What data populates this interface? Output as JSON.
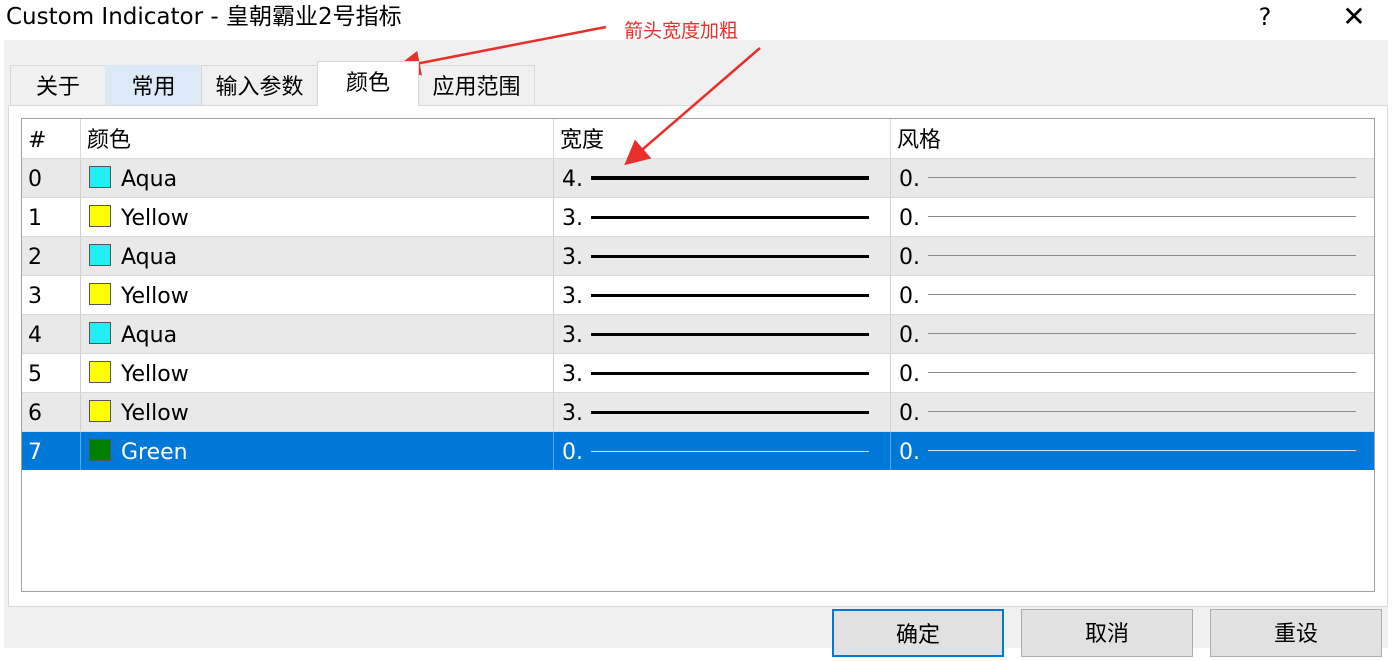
{
  "window": {
    "title": "Custom Indicator - 皇朝霸业2号指标",
    "help_label": "?",
    "close_label": "✕"
  },
  "tabs": [
    {
      "label": "关于"
    },
    {
      "label": "常用"
    },
    {
      "label": "输入参数"
    },
    {
      "label": "颜色",
      "active": true
    },
    {
      "label": "应用范围"
    }
  ],
  "grid": {
    "headers": {
      "index": "#",
      "color": "颜色",
      "width": "宽度",
      "style": "风格"
    },
    "rows": [
      {
        "index": "0",
        "color_name": "Aqua",
        "color_hex": "#22eef6",
        "width_text": "4.",
        "width_value": 4,
        "style_text": "0."
      },
      {
        "index": "1",
        "color_name": "Yellow",
        "color_hex": "#ffff00",
        "width_text": "3.",
        "width_value": 3,
        "style_text": "0."
      },
      {
        "index": "2",
        "color_name": "Aqua",
        "color_hex": "#22eef6",
        "width_text": "3.",
        "width_value": 3,
        "style_text": "0."
      },
      {
        "index": "3",
        "color_name": "Yellow",
        "color_hex": "#ffff00",
        "width_text": "3.",
        "width_value": 3,
        "style_text": "0."
      },
      {
        "index": "4",
        "color_name": "Aqua",
        "color_hex": "#22eef6",
        "width_text": "3.",
        "width_value": 3,
        "style_text": "0."
      },
      {
        "index": "5",
        "color_name": "Yellow",
        "color_hex": "#ffff00",
        "width_text": "3.",
        "width_value": 3,
        "style_text": "0."
      },
      {
        "index": "6",
        "color_name": "Yellow",
        "color_hex": "#ffff00",
        "width_text": "3.",
        "width_value": 3,
        "style_text": "0."
      },
      {
        "index": "7",
        "color_name": "Green",
        "color_hex": "#007f00",
        "width_text": "0.",
        "width_value": 0,
        "style_text": "0.",
        "selected": true
      }
    ]
  },
  "buttons": {
    "ok": "确定",
    "cancel": "取消",
    "reset": "重设"
  },
  "annotation": {
    "text": "箭头宽度加粗",
    "color": "#e8302a"
  },
  "colors": {
    "selection": "#0078d7",
    "tab_hover": "#dce9f6",
    "dialog_bg": "#f0f0f0"
  }
}
